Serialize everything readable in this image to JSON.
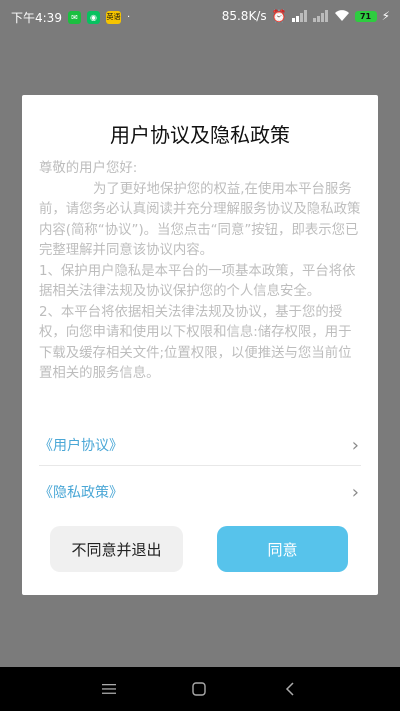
{
  "status_bar": {
    "time": "下午4:39",
    "app_badge": "英语",
    "dot": "·",
    "network_speed": "85.8K/s",
    "battery": "71"
  },
  "dialog": {
    "title": "用户协议及隐私政策",
    "greeting": "尊敬的用户您好:",
    "paragraph1": "为了更好地保护您的权益,在使用本平台服务前，请您务必认真阅读并充分理解服务协议及隐私政策内容(简称“协议”)。当您点击“同意”按钮，即表示您已完整理解并同意该协议内容。",
    "paragraph2": "1、保护用户隐私是本平台的一项基本政策，平台将依据相关法律法规及协议保护您的个人信息安全。",
    "paragraph3": "2、本平台将依据相关法律法规及协议，基于您的授权，向您申请和使用以下权限和信息:储存权限，用于下载及缓存相关文件;位置权限，以便推送与您当前位置相关的服务信息。",
    "links": [
      {
        "label": "《用户协议》"
      },
      {
        "label": "《隐私政策》"
      }
    ],
    "decline_label": "不同意并退出",
    "agree_label": "同意"
  },
  "colors": {
    "link": "#4aa7d6",
    "agree_button": "#57c3eb",
    "overlay": "#7b7b7b"
  },
  "icons": {
    "nav_menu": "menu-icon",
    "nav_home": "home-icon",
    "nav_back": "back-icon"
  }
}
